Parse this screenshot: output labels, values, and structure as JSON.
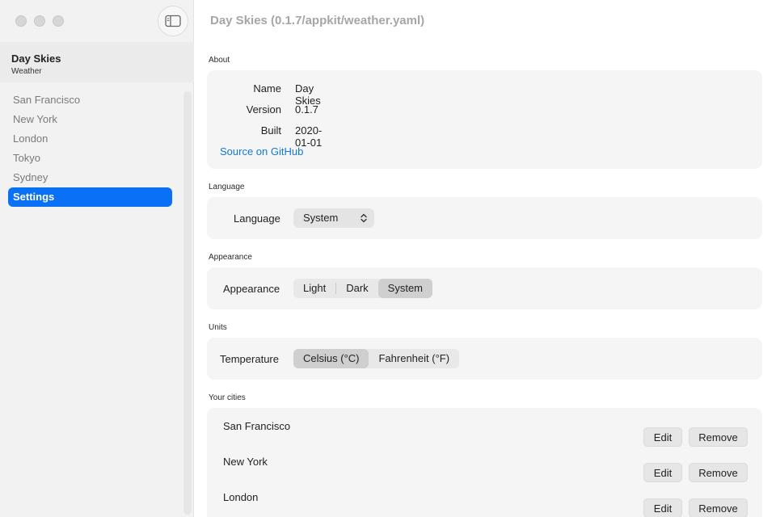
{
  "window": {
    "title": "Day Skies (0.1.7/appkit/weather.yaml)",
    "accent": "#0a70f5"
  },
  "sidebar": {
    "app_name": "Day Skies",
    "app_subtitle": "Weather",
    "toggle_icon": "sidebar-icon",
    "items": [
      {
        "label": "San Francisco"
      },
      {
        "label": "New York"
      },
      {
        "label": "London"
      },
      {
        "label": "Tokyo"
      },
      {
        "label": "Sydney"
      },
      {
        "label": "Settings",
        "active": true
      }
    ]
  },
  "about": {
    "section": "About",
    "name_key": "Name",
    "name_val": "Day Skies",
    "version_key": "Version",
    "version_val": "0.1.7",
    "built_key": "Built",
    "built_val": "2020-01-01",
    "link": "Source on GitHub"
  },
  "language": {
    "section": "Language",
    "label": "Language",
    "selected": "System"
  },
  "appearance": {
    "section": "Appearance",
    "label": "Appearance",
    "options": [
      "Light",
      "Dark",
      "System"
    ],
    "selected": "System"
  },
  "units": {
    "section": "Units",
    "label": "Temperature",
    "options": [
      "Celsius (°C)",
      "Fahrenheit (°F)"
    ],
    "selected": "Celsius (°C)"
  },
  "cities": {
    "section": "Your cities",
    "edit_label": "Edit",
    "remove_label": "Remove",
    "items": [
      {
        "name": "San Francisco"
      },
      {
        "name": "New York"
      },
      {
        "name": "London"
      }
    ]
  }
}
